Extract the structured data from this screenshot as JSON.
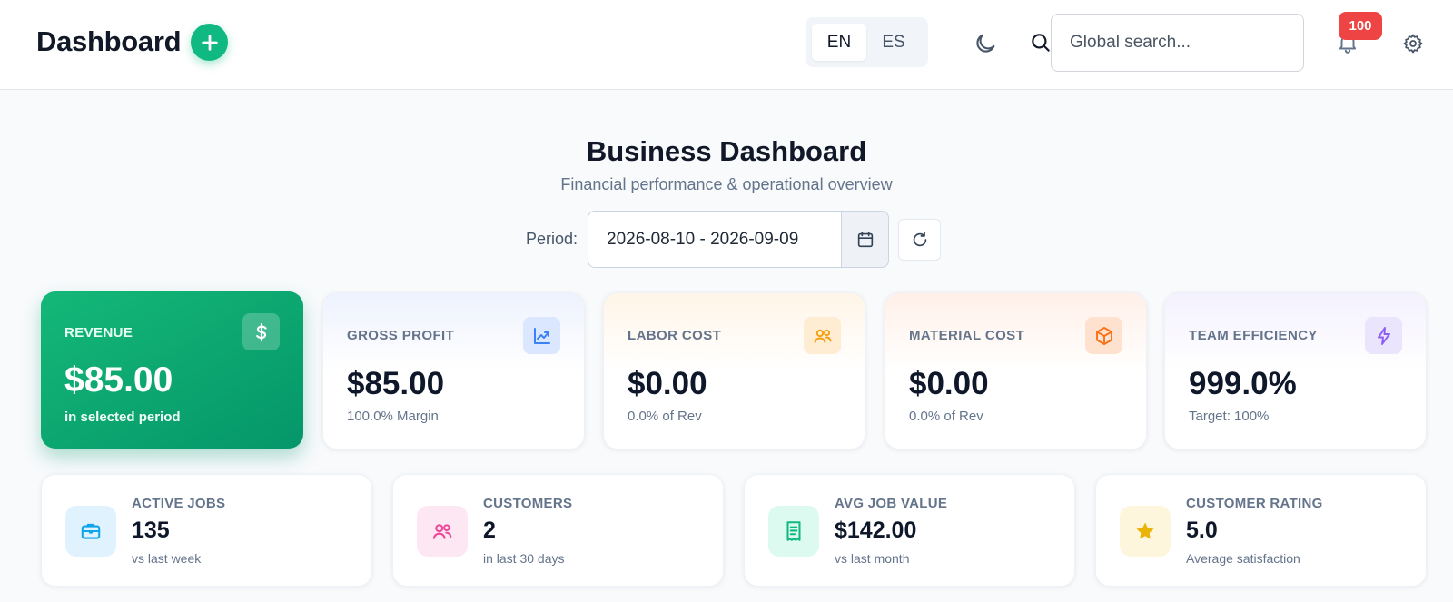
{
  "header": {
    "title": "Dashboard",
    "languages": [
      "EN",
      "ES"
    ],
    "active_language": "EN",
    "search_placeholder": "Global search...",
    "notification_count": "100"
  },
  "page": {
    "title": "Business Dashboard",
    "subtitle": "Financial performance & operational overview",
    "period_label": "Period:",
    "period_value": "2026-08-10 - 2026-09-09"
  },
  "kpis": [
    {
      "label": "REVENUE",
      "value": "$85.00",
      "sub": "in selected period",
      "icon": "dollar-icon",
      "accent": "#059669"
    },
    {
      "label": "GROSS PROFIT",
      "value": "$85.00",
      "sub": "100.0% Margin",
      "icon": "chart-line-icon",
      "accent": "#3b82f6"
    },
    {
      "label": "LABOR COST",
      "value": "$0.00",
      "sub": "0.0% of Rev",
      "icon": "users-icon",
      "accent": "#f59e0b"
    },
    {
      "label": "MATERIAL COST",
      "value": "$0.00",
      "sub": "0.0% of Rev",
      "icon": "box-icon",
      "accent": "#f97316"
    },
    {
      "label": "TEAM EFFICIENCY",
      "value": "999.0%",
      "sub": "Target: 100%",
      "icon": "bolt-icon",
      "accent": "#8b5cf6"
    }
  ],
  "stats": [
    {
      "label": "ACTIVE JOBS",
      "value": "135",
      "sub": "vs last week",
      "icon": "briefcase-icon",
      "accent": "#0ea5e9"
    },
    {
      "label": "CUSTOMERS",
      "value": "2",
      "sub": "in last 30 days",
      "icon": "users-icon",
      "accent": "#ec4899"
    },
    {
      "label": "AVG JOB VALUE",
      "value": "$142.00",
      "sub": "vs last month",
      "icon": "receipt-icon",
      "accent": "#10b981"
    },
    {
      "label": "CUSTOMER RATING",
      "value": "5.0",
      "sub": "Average satisfaction",
      "icon": "star-icon",
      "accent": "#eab308"
    }
  ]
}
